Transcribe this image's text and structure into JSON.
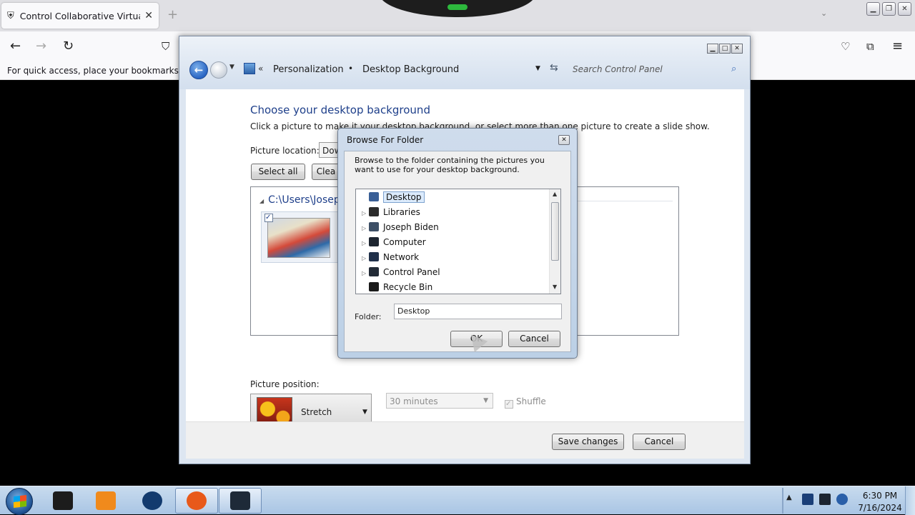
{
  "browser": {
    "tab_title": "Control Collaborative Virtual M",
    "tab_close": "✕",
    "new_tab": "+",
    "bookmarks_hint": "For quick access, place your bookmarks here o"
  },
  "control_panel": {
    "breadcrumb_overflow": "«",
    "breadcrumb": [
      "Personalization",
      "Desktop Background"
    ],
    "breadcrumb_separator": "•",
    "search_placeholder": "Search Control Panel",
    "heading": "Choose your desktop background",
    "description": "Click a picture to make it your desktop background, or select more than one picture to create a slide show.",
    "picture_location_label": "Picture location:",
    "picture_location_value": "Dow",
    "select_all_label": "Select all",
    "clear_all_label": "Clea",
    "folder_group_title": "C:\\Users\\Joseph",
    "picture_position_label": "Picture position:",
    "picture_position_value": "Stretch",
    "interval_value": "30 minutes",
    "shuffle_label": "Shuffle",
    "save_label": "Save changes",
    "cancel_label": "Cancel"
  },
  "browse_dialog": {
    "title": "Browse For Folder",
    "instruction": "Browse to the folder containing the pictures you want to use for your desktop background.",
    "tree": [
      {
        "label": "Desktop",
        "icon": "desktop-icon",
        "color": "#3a5f96",
        "expandable": false,
        "selected": true
      },
      {
        "label": "Libraries",
        "icon": "libraries-icon",
        "color": "#2b2b2b",
        "expandable": true,
        "selected": false
      },
      {
        "label": "Joseph Biden",
        "icon": "user-folder-icon",
        "color": "#3d4f66",
        "expandable": true,
        "selected": false
      },
      {
        "label": "Computer",
        "icon": "computer-icon",
        "color": "#1d2530",
        "expandable": true,
        "selected": false
      },
      {
        "label": "Network",
        "icon": "network-icon",
        "color": "#20304a",
        "expandable": true,
        "selected": false
      },
      {
        "label": "Control Panel",
        "icon": "control-panel-icon",
        "color": "#222a36",
        "expandable": true,
        "selected": false
      },
      {
        "label": "Recycle Bin",
        "icon": "recycle-bin-icon",
        "color": "#1a1a1a",
        "expandable": false,
        "selected": false
      }
    ],
    "folder_label": "Folder:",
    "folder_value": "Desktop",
    "ok_label": "OK",
    "cancel_label": "Cancel"
  },
  "taskbar": {
    "time": "6:30 PM",
    "date": "7/16/2024",
    "apps": [
      {
        "name": "vm-app-icon",
        "color": "#1c1c1c"
      },
      {
        "name": "media-player-icon",
        "color": "#f08a1c"
      },
      {
        "name": "globe-icon",
        "color": "#123a6e"
      },
      {
        "name": "firefox-icon",
        "color": "#e8591a"
      },
      {
        "name": "remote-desktop-icon",
        "color": "#1e2a38"
      }
    ]
  }
}
